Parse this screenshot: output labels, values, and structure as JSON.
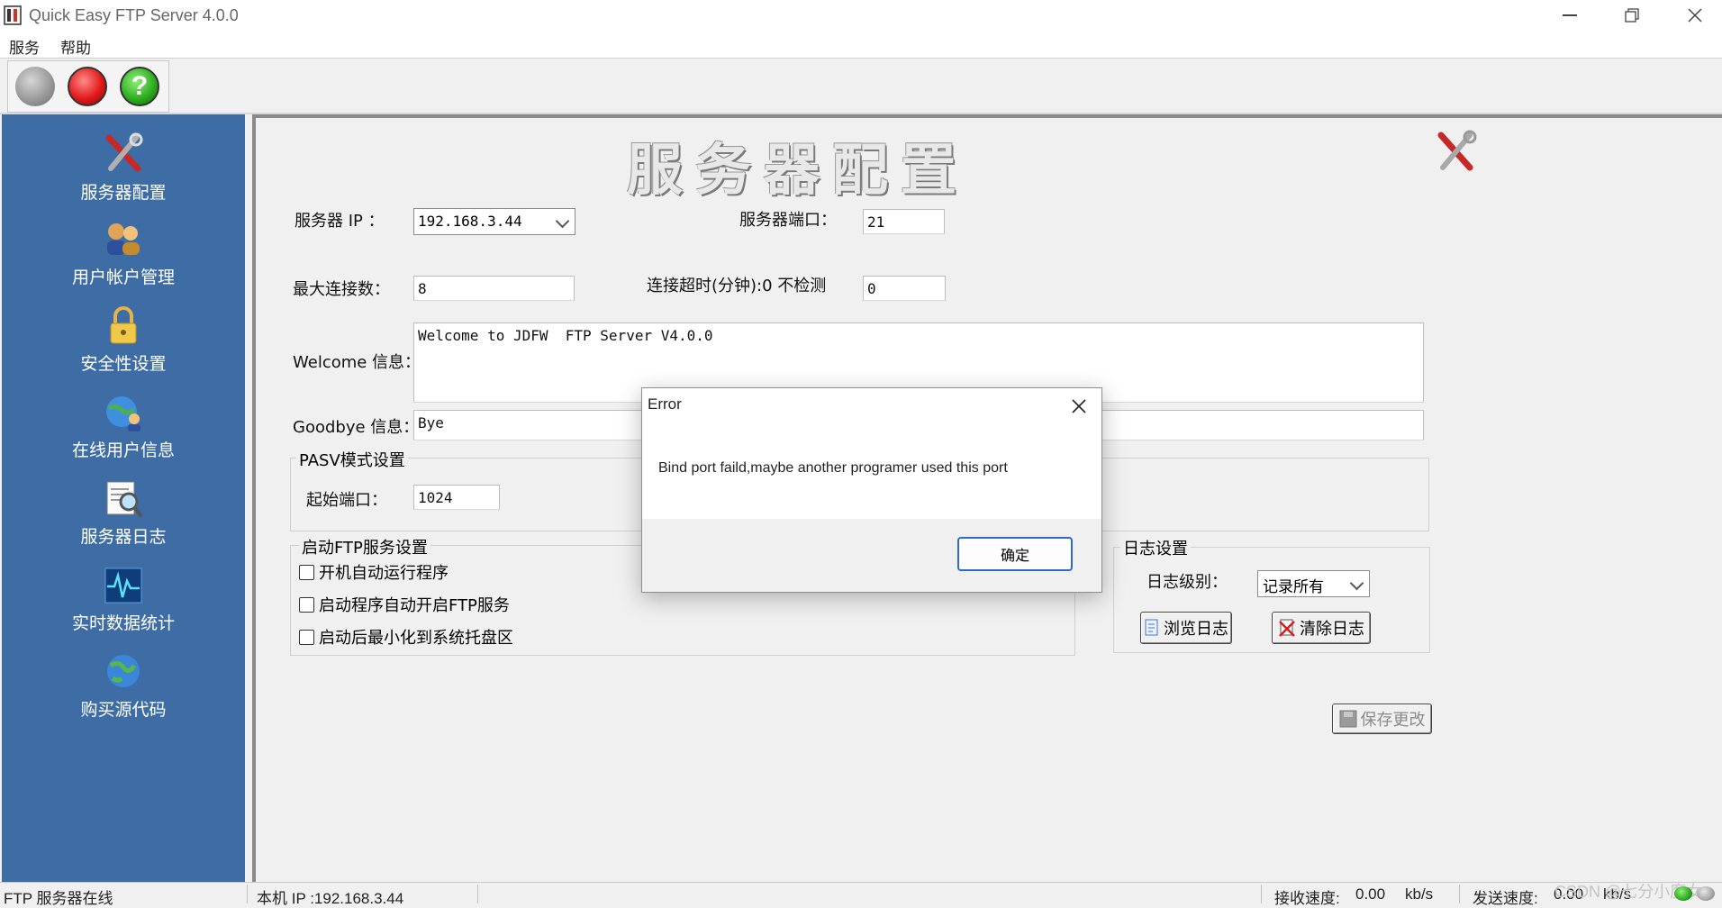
{
  "window": {
    "title": "Quick Easy FTP Server 4.0.0"
  },
  "menu": {
    "items": [
      "服务",
      "帮助"
    ]
  },
  "sidebar": {
    "items": [
      {
        "label": "服务器配置",
        "icon": "tools-icon"
      },
      {
        "label": "用户帐户管理",
        "icon": "users-icon"
      },
      {
        "label": "安全性设置",
        "icon": "padlock-icon"
      },
      {
        "label": "在线用户信息",
        "icon": "globe-users-icon"
      },
      {
        "label": "服务器日志",
        "icon": "log-magnifier-icon"
      },
      {
        "label": "实时数据统计",
        "icon": "pulse-chart-icon"
      },
      {
        "label": "购买源代码",
        "icon": "globe-icon"
      }
    ]
  },
  "main": {
    "banner": "服务器配置",
    "server_ip": {
      "label": "服务器 IP ：",
      "value": "192.168.3.44"
    },
    "server_port": {
      "label": "服务器端口：",
      "value": "21"
    },
    "max_conn": {
      "label": "最大连接数：",
      "value": "8"
    },
    "timeout": {
      "label": "连接超时(分钟):0 不检测",
      "value": "0"
    },
    "welcome": {
      "label": "Welcome 信息：",
      "value": "Welcome to JDFW  FTP Server V4.0.0"
    },
    "goodbye": {
      "label": "Goodbye 信息：",
      "value": "Bye"
    },
    "pasv": {
      "title": "PASV模式设置",
      "start_port_label": "起始端口：",
      "start_port": "1024"
    },
    "startup": {
      "title": "启动FTP服务设置",
      "options": [
        "开机自动运行程序",
        "启动程序自动开启FTP服务",
        "启动后最小化到系统托盘区"
      ]
    },
    "log": {
      "title": "日志设置",
      "level_label": "日志级别：",
      "level_value": "记录所有",
      "browse_label": "浏览日志",
      "clear_label": "清除日志"
    },
    "save_label": "保存更改"
  },
  "dialog": {
    "title": "Error",
    "message": "Bind port faild,maybe another programer used this port",
    "ok_label": "确定"
  },
  "status": {
    "server_state": "FTP 服务器在线",
    "local_ip": "本机 IP :192.168.3.44",
    "recv_label": "接收速度:",
    "recv_value": "0.00",
    "recv_unit": "kb/s",
    "send_label": "发送速度:",
    "send_value": "0.00",
    "send_unit": "kb/s",
    "watermark": "CSDN @七分小魔女"
  },
  "colors": {
    "sidebar": "#3e6da5",
    "dialog_ok_border": "#2d6bc4"
  }
}
